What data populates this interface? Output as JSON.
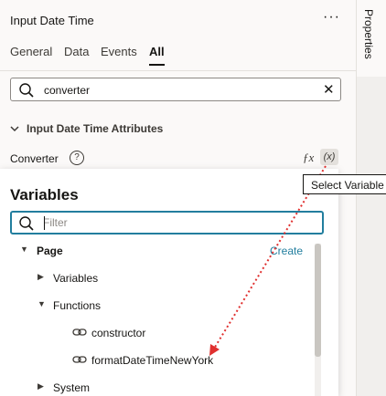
{
  "header": {
    "title": "Input Date Time",
    "more_icon": "more-horizontal-icon",
    "more_glyph": "···"
  },
  "tabs": [
    {
      "label": "General",
      "active": false
    },
    {
      "label": "Data",
      "active": false
    },
    {
      "label": "Events",
      "active": false
    },
    {
      "label": "All",
      "active": true
    }
  ],
  "side_tab": {
    "label": "Properties"
  },
  "search": {
    "value": "converter",
    "icon": "search-icon",
    "clear_icon": "close-icon",
    "clear_glyph": "✕"
  },
  "section": {
    "label": "Input Date Time Attributes",
    "expanded": true,
    "chevron": "⌄"
  },
  "attribute": {
    "label": "Converter",
    "help_glyph": "?",
    "fx_label": "ƒx",
    "variable_button_label": "(x)"
  },
  "tooltip": {
    "text": "Select Variable"
  },
  "variables_popup": {
    "title": "Variables",
    "filter_placeholder": "Filter",
    "create_label": "Create",
    "tree": [
      {
        "label": "Page",
        "arrow": "▼",
        "bold": true
      },
      {
        "label": "Variables",
        "arrow": "▶"
      },
      {
        "label": "Functions",
        "arrow": "▼"
      },
      {
        "label": "constructor",
        "icon": "link-icon"
      },
      {
        "label": "formatDateTimeNewYork",
        "icon": "link-icon"
      },
      {
        "label": "System",
        "arrow": "▶"
      }
    ]
  },
  "colors": {
    "accent": "#227e9e",
    "annotation_arrow": "#e0302f",
    "panel_bg": "#fbf9f8",
    "text": "#161513"
  }
}
